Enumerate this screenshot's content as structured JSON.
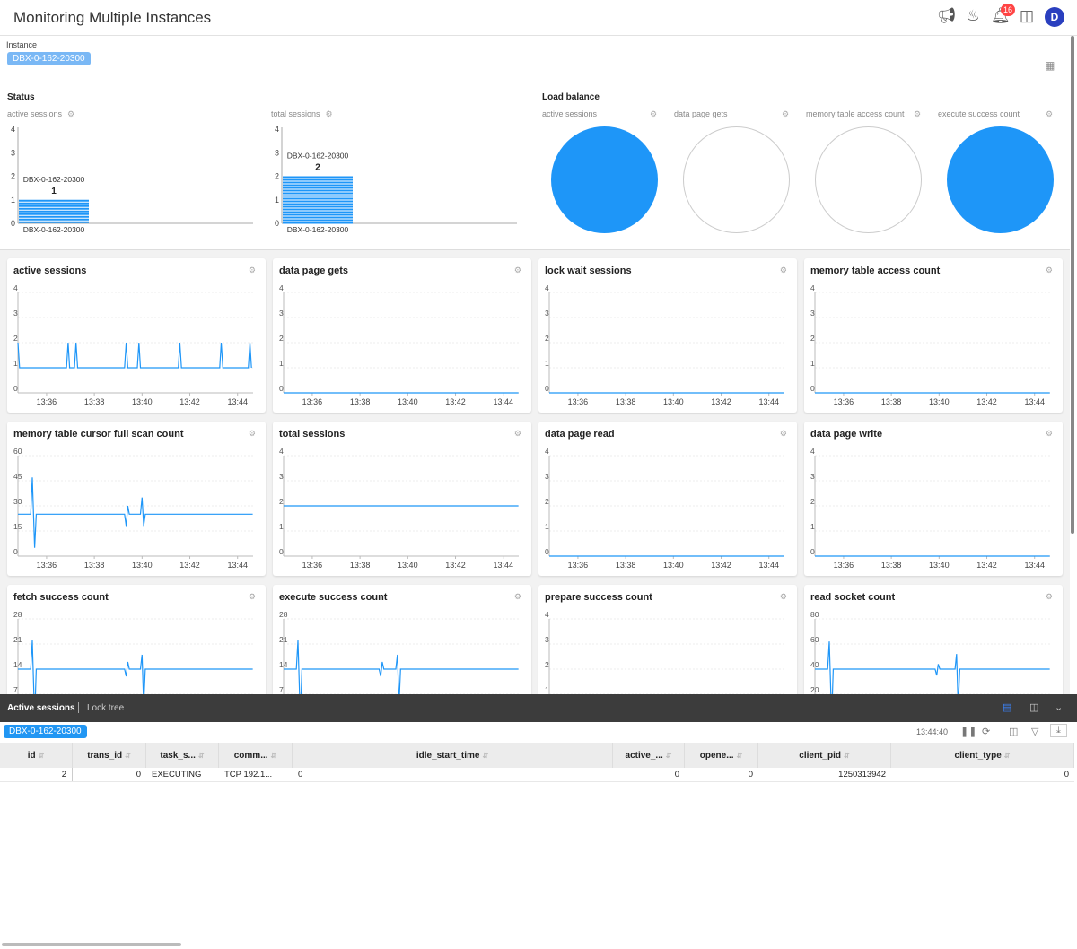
{
  "header": {
    "title": "Monitoring Multiple Instances",
    "notification_count": "16",
    "avatar_letter": "D",
    "icons": [
      "megaphone-icon",
      "paint-bucket-icon",
      "bell-icon",
      "info-panel-icon"
    ]
  },
  "instance": {
    "label": "Instance",
    "selected": "DBX-0-162-20300"
  },
  "status": {
    "title": "Status",
    "charts": [
      {
        "title": "active sessions",
        "yticks": [
          "0",
          "1",
          "2",
          "3",
          "4"
        ],
        "ymax": 4,
        "category": "DBX-0-162-20300",
        "value": 1,
        "value_label": "1"
      },
      {
        "title": "total sessions",
        "yticks": [
          "0",
          "1",
          "2",
          "3",
          "4"
        ],
        "ymax": 4,
        "category": "DBX-0-162-20300",
        "value": 2,
        "value_label": "2"
      }
    ]
  },
  "load_balance": {
    "title": "Load balance",
    "pies": [
      {
        "title": "active sessions",
        "filled": true
      },
      {
        "title": "data page gets",
        "filled": false
      },
      {
        "title": "memory table access count",
        "filled": false
      },
      {
        "title": "execute success count",
        "filled": true
      }
    ]
  },
  "accent": "#1e96f8",
  "xticks": [
    "13:36",
    "13:38",
    "13:40",
    "13:42",
    "13:44"
  ],
  "charts": [
    {
      "title": "active sessions",
      "yticks": [
        0,
        1,
        2,
        3,
        4
      ],
      "points": [
        [
          "13:34:48",
          2
        ],
        [
          "13:34:52",
          1
        ],
        [
          "13:36:50",
          1
        ],
        [
          "13:36:54",
          2
        ],
        [
          "13:36:58",
          1
        ],
        [
          "13:37:10",
          1
        ],
        [
          "13:37:14",
          2
        ],
        [
          "13:37:18",
          1
        ],
        [
          "13:39:16",
          1
        ],
        [
          "13:39:20",
          2
        ],
        [
          "13:39:24",
          1
        ],
        [
          "13:39:48",
          1
        ],
        [
          "13:39:52",
          2
        ],
        [
          "13:39:56",
          1
        ],
        [
          "13:41:31",
          1
        ],
        [
          "13:41:35",
          2
        ],
        [
          "13:41:39",
          1
        ],
        [
          "13:43:15",
          1
        ],
        [
          "13:43:19",
          2
        ],
        [
          "13:43:23",
          1
        ],
        [
          "13:44:27",
          1
        ],
        [
          "13:44:31",
          2
        ],
        [
          "13:44:35",
          1
        ]
      ]
    },
    {
      "title": "data page gets",
      "yticks": [
        0,
        1,
        2,
        3,
        4
      ],
      "points": [
        [
          "13:34:48",
          0
        ],
        [
          "13:44:38",
          0
        ]
      ]
    },
    {
      "title": "lock wait sessions",
      "yticks": [
        0,
        1,
        2,
        3,
        4
      ],
      "points": [
        [
          "13:34:48",
          0
        ],
        [
          "13:44:38",
          0
        ]
      ]
    },
    {
      "title": "memory table access count",
      "yticks": [
        0,
        1,
        2,
        3,
        4
      ],
      "points": [
        [
          "13:34:48",
          0
        ],
        [
          "13:44:38",
          0
        ]
      ]
    },
    {
      "title": "memory table cursor full scan count",
      "yticks": [
        0,
        15,
        30,
        45,
        60
      ],
      "points": [
        [
          "13:34:48",
          25
        ],
        [
          "13:35:20",
          25
        ],
        [
          "13:35:24",
          47
        ],
        [
          "13:35:30",
          5
        ],
        [
          "13:35:34",
          25
        ],
        [
          "13:39:16",
          25
        ],
        [
          "13:39:20",
          18
        ],
        [
          "13:39:24",
          30
        ],
        [
          "13:39:28",
          25
        ],
        [
          "13:39:56",
          25
        ],
        [
          "13:40:00",
          35
        ],
        [
          "13:40:04",
          18
        ],
        [
          "13:40:08",
          25
        ],
        [
          "13:44:38",
          25
        ]
      ]
    },
    {
      "title": "total sessions",
      "yticks": [
        0,
        1,
        2,
        3,
        4
      ],
      "points": [
        [
          "13:34:48",
          2
        ],
        [
          "13:44:38",
          2
        ]
      ]
    },
    {
      "title": "data page read",
      "yticks": [
        0,
        1,
        2,
        3,
        4
      ],
      "points": [
        [
          "13:34:48",
          0
        ],
        [
          "13:44:38",
          0
        ]
      ]
    },
    {
      "title": "data page write",
      "yticks": [
        0,
        1,
        2,
        3,
        4
      ],
      "points": [
        [
          "13:34:48",
          0
        ],
        [
          "13:44:38",
          0
        ]
      ]
    },
    {
      "title": "fetch success count",
      "yticks": [
        0,
        7,
        14,
        21,
        28
      ],
      "points": [
        [
          "13:34:48",
          14
        ],
        [
          "13:35:20",
          14
        ],
        [
          "13:35:24",
          22
        ],
        [
          "13:35:30",
          0
        ],
        [
          "13:35:34",
          14
        ],
        [
          "13:39:16",
          14
        ],
        [
          "13:39:20",
          12
        ],
        [
          "13:39:24",
          16
        ],
        [
          "13:39:28",
          14
        ],
        [
          "13:39:56",
          14
        ],
        [
          "13:40:00",
          18
        ],
        [
          "13:40:04",
          4
        ],
        [
          "13:40:08",
          14
        ],
        [
          "13:44:38",
          14
        ]
      ]
    },
    {
      "title": "execute success count",
      "yticks": [
        0,
        7,
        14,
        21,
        28
      ],
      "points": [
        [
          "13:34:48",
          14
        ],
        [
          "13:35:20",
          14
        ],
        [
          "13:35:24",
          22
        ],
        [
          "13:35:30",
          0
        ],
        [
          "13:35:34",
          14
        ],
        [
          "13:38:48",
          14
        ],
        [
          "13:38:52",
          12
        ],
        [
          "13:38:56",
          16
        ],
        [
          "13:39:00",
          14
        ],
        [
          "13:39:30",
          14
        ],
        [
          "13:39:34",
          18
        ],
        [
          "13:39:38",
          4
        ],
        [
          "13:39:42",
          14
        ],
        [
          "13:44:38",
          14
        ]
      ]
    },
    {
      "title": "prepare success count",
      "yticks": [
        0,
        1,
        2,
        3,
        4
      ],
      "points": [
        [
          "13:34:48",
          0
        ],
        [
          "13:44:38",
          0
        ]
      ]
    },
    {
      "title": "read socket count",
      "yticks": [
        0,
        20,
        40,
        60,
        80
      ],
      "points": [
        [
          "13:34:48",
          40
        ],
        [
          "13:35:20",
          40
        ],
        [
          "13:35:24",
          62
        ],
        [
          "13:35:30",
          0
        ],
        [
          "13:35:34",
          40
        ],
        [
          "13:39:50",
          40
        ],
        [
          "13:39:54",
          35
        ],
        [
          "13:39:58",
          44
        ],
        [
          "13:40:02",
          40
        ],
        [
          "13:40:40",
          40
        ],
        [
          "13:40:44",
          52
        ],
        [
          "13:40:48",
          10
        ],
        [
          "13:40:52",
          40
        ],
        [
          "13:44:38",
          40
        ]
      ]
    }
  ],
  "bottom": {
    "tabs": [
      "Active sessions",
      "Lock tree"
    ],
    "instance": "DBX-0-162-20300",
    "time": "13:44:40",
    "columns": [
      "id",
      "trans_id",
      "task_s...",
      "comm...",
      "idle_start_time",
      "active_...",
      "opene...",
      "client_pid",
      "client_type"
    ],
    "rows": [
      [
        "2",
        "0",
        "EXECUTING",
        "TCP 192.1...",
        "0",
        "0",
        "0",
        "1250313942",
        "0"
      ]
    ]
  }
}
